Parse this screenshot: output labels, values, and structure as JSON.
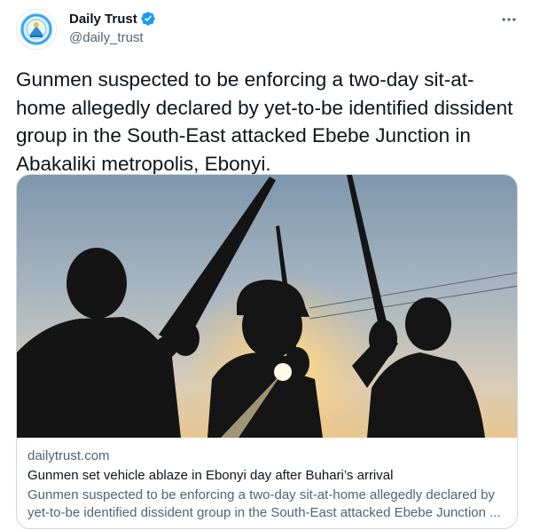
{
  "account": {
    "display_name": "Daily Trust",
    "handle": "@daily_trust",
    "verified": true,
    "avatar_icon": "daily-trust-logo",
    "brand_color": "#1d9bf0"
  },
  "tweet": {
    "text": "Gunmen suspected to be enforcing a two-day sit-at-home allegedly declared by yet-to-be identified dissident group in the South-East attacked Ebebe Junction in Abakaliki metropolis, Ebonyi."
  },
  "menu": {
    "icon": "more-horizontal-icon"
  },
  "link_card": {
    "domain": "dailytrust.com",
    "title": "Gunmen set vehicle ablaze in Ebonyi day after Buhari’s arrival",
    "description_line1": "Gunmen suspected to be enforcing a two-day sit-at-home allegedly declared by",
    "description_line2": "yet-to-be identified dissident group in the South-East attacked Ebebe Junction ...",
    "image_icon": "armed-silhouettes-sunset-photo"
  }
}
